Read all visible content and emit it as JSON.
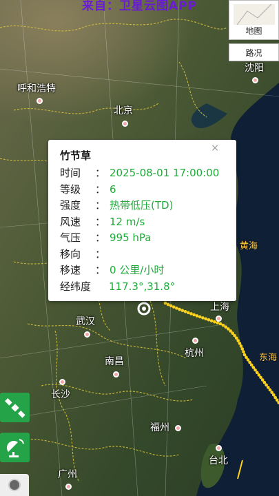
{
  "source_banner": "来自：卫星云图APP",
  "map_buttons": {
    "map": "地图",
    "traffic": "路况"
  },
  "cities": [
    {
      "name": "呼和浩特"
    },
    {
      "name": "北京"
    },
    {
      "name": "沈阳"
    },
    {
      "name": "上海"
    },
    {
      "name": "武汉"
    },
    {
      "name": "杭州"
    },
    {
      "name": "南昌"
    },
    {
      "name": "长沙"
    },
    {
      "name": "福州"
    },
    {
      "name": "台北"
    },
    {
      "name": "广州"
    }
  ],
  "seas": {
    "yellow_sea": "黄海",
    "east_sea": "东海"
  },
  "popup": {
    "title": "竹节草",
    "close": "×",
    "rows": [
      {
        "key": "时间",
        "sep": "：",
        "value": "2025-08-01 17:00:00"
      },
      {
        "key": "等级",
        "sep": "：",
        "value": "6"
      },
      {
        "key": "强度",
        "sep": "：",
        "value": "热带低压(TD)"
      },
      {
        "key": "风速",
        "sep": "：",
        "value": "12 m/s"
      },
      {
        "key": "气压",
        "sep": "：",
        "value": "995 hPa"
      },
      {
        "key": "移向",
        "sep": "：",
        "value": ""
      },
      {
        "key": "移速",
        "sep": "：",
        "value": "0 公里/小时"
      },
      {
        "key": "经纬度",
        "sep": "：",
        "value": "117.3°,31.8°"
      }
    ]
  },
  "tools": {
    "satellite": "satellite-icon",
    "radar": "radar-icon",
    "record": "record-icon"
  },
  "colors": {
    "accent_green": "#1faa3a",
    "banner_purple": "#6a1bd6",
    "track_yellow": "#ffd21a",
    "track_blue": "#2a6fe0"
  }
}
